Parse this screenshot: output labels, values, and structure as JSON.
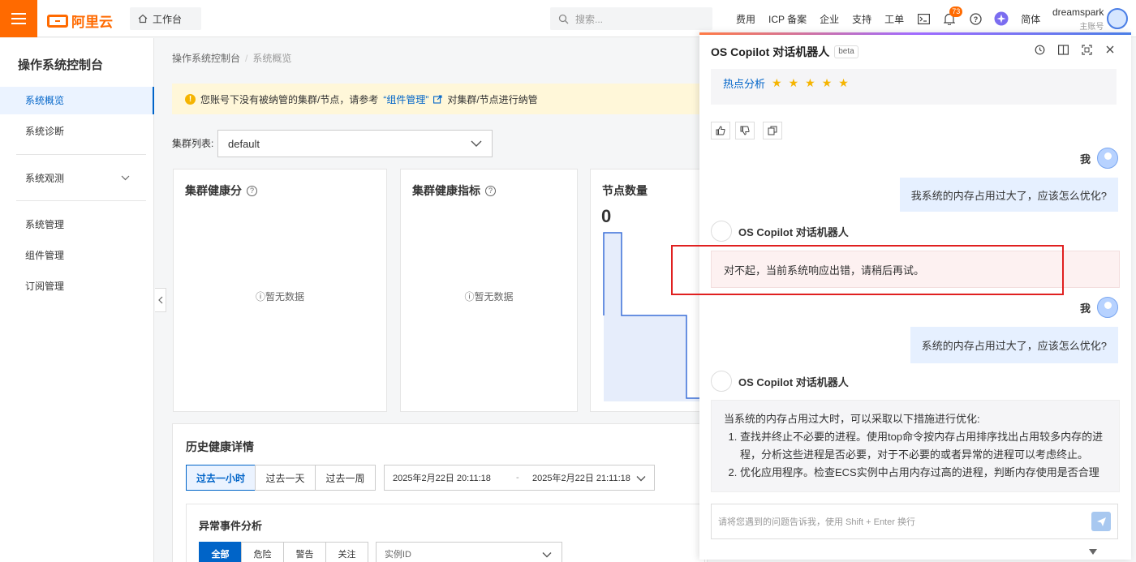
{
  "topbar": {
    "logo_text": "阿里云",
    "workbench_label": "工作台",
    "search_placeholder": "搜索...",
    "nav": [
      "费用",
      "ICP 备案",
      "企业",
      "支持",
      "工单"
    ],
    "notification_count": "73",
    "lang_label": "简体",
    "user_name": "dreamspark",
    "user_sub": "主账号"
  },
  "sidebar": {
    "title": "操作系统控制台",
    "items": [
      {
        "label": "系统概览",
        "active": true
      },
      {
        "label": "系统诊断"
      },
      {
        "label": "系统观测"
      },
      {
        "label": "系统管理"
      },
      {
        "label": "组件管理"
      },
      {
        "label": "订阅管理"
      }
    ]
  },
  "main": {
    "breadcrumb": [
      "操作系统控制台",
      "系统概览"
    ],
    "notice": {
      "text1": "您账号下没有被纳管的集群/节点，请参考",
      "link": "“组件管理”",
      "text2": "对集群/节点进行纳管"
    },
    "cluster_label": "集群列表:",
    "cluster_value": "default",
    "cards": [
      {
        "title": "集群健康分",
        "empty": "暂无数据"
      },
      {
        "title": "集群健康指标",
        "empty": "暂无数据"
      },
      {
        "title": "节点数量",
        "value": "0"
      }
    ],
    "history": {
      "title": "历史健康详情",
      "ranges": [
        "过去一小时",
        "过去一天",
        "过去一周"
      ],
      "start": "2025年2月22日 20:11:18",
      "dash": "-",
      "end": "2025年2月22日 21:11:18",
      "abnormal_title": "异常事件分析",
      "tabs": [
        "全部",
        "危险",
        "警告",
        "关注"
      ],
      "instance_placeholder": "实例ID"
    }
  },
  "copilot": {
    "title": "OS Copilot 对话机器人",
    "beta": "beta",
    "hot_link": "热点分析",
    "me_label": "我",
    "bot_name": "OS Copilot 对话机器人",
    "msg_user_1": "我系统的内存占用过大了，应该怎么优化?",
    "msg_bot_1": "对不起，当前系统响应出错，请稍后再试。",
    "msg_user_2": "系统的内存占用过大了，应该怎么优化?",
    "msg_bot_2_intro": "当系统的内存占用过大时，可以采取以下措施进行优化:",
    "msg_bot_2_item1": "查找并终止不必要的进程。使用top命令按内存占用排序找出占用较多内存的进程，分析这些进程是否必要，对于不必要的或者异常的进程可以考虑终止。",
    "msg_bot_2_item2": "优化应用程序。检查ECS实例中占用内存过高的进程，判断内存使用是否合理",
    "input_placeholder": "请将您遇到的问题告诉我，使用 Shift + Enter 换行"
  }
}
